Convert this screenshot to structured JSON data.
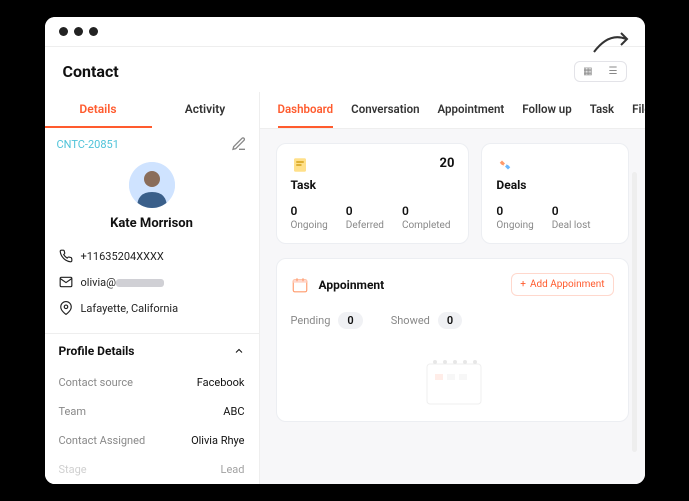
{
  "header": {
    "title": "Contact"
  },
  "left": {
    "tabs": {
      "details": "Details",
      "activity": "Activity"
    },
    "contact_id": "CNTC-20851",
    "name": "Kate Morrison",
    "phone": "+11635204XXXX",
    "email_prefix": "olivia@",
    "location": "Lafayette, California",
    "profile_header": "Profile Details",
    "fields": {
      "source": {
        "k": "Contact source",
        "v": "Facebook"
      },
      "team": {
        "k": "Team",
        "v": "ABC"
      },
      "assigned": {
        "k": "Contact Assigned",
        "v": "Olivia Rhye"
      },
      "stage": {
        "k": "Stage",
        "v": "Lead"
      }
    }
  },
  "right": {
    "tabs": {
      "dashboard": "Dashboard",
      "conversation": "Conversation",
      "appointment": "Appointment",
      "followup": "Follow up",
      "task": "Task",
      "file": "File"
    },
    "task_card": {
      "title": "Task",
      "count": "20",
      "stats": {
        "ongoing": {
          "n": "0",
          "l": "Ongoing"
        },
        "deferred": {
          "n": "0",
          "l": "Deferred"
        },
        "completed": {
          "n": "0",
          "l": "Completed"
        }
      }
    },
    "deals_card": {
      "title": "Deals",
      "stats": {
        "ongoing": {
          "n": "0",
          "l": "Ongoing"
        },
        "lost": {
          "n": "0",
          "l": "Deal lost"
        }
      }
    },
    "appointment": {
      "title": "Appoinment",
      "add_label": "Add Appoinment",
      "pending": {
        "l": "Pending",
        "n": "0"
      },
      "showed": {
        "l": "Showed",
        "n": "0"
      }
    }
  }
}
